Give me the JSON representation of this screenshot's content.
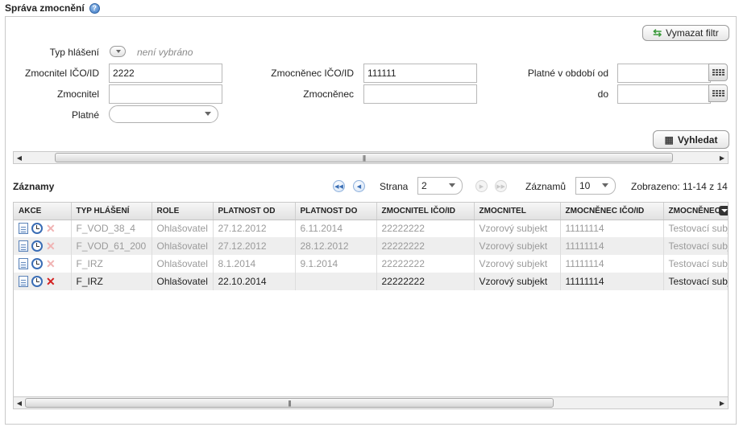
{
  "page": {
    "title": "Správa zmocnění"
  },
  "filter": {
    "clear_button": "Vymazat filtr",
    "typ_label": "Typ hlášení",
    "typ_value": "není vybráno",
    "zmocnitel_ico_label": "Zmocnitel IČO/ID",
    "zmocnitel_ico_value": "2222",
    "zmocnenec_ico_label": "Zmocněnec IČO/ID",
    "zmocnenec_ico_value": "111111",
    "platne_od_label": "Platné v období od",
    "platne_do_label": "do",
    "zmocnitel_label": "Zmocnitel",
    "zmocnenec_label": "Zmocněnec",
    "platne_label": "Platné",
    "search_button": "Vyhledat"
  },
  "records": {
    "title": "Záznamy",
    "page_label": "Strana",
    "page_value": "2",
    "per_page_label": "Záznamů",
    "per_page_value": "10",
    "shown": "Zobrazeno: 11-14 z 14"
  },
  "grid": {
    "columns": [
      "AKCE",
      "TYP HLÁŠENÍ",
      "ROLE",
      "PLATNOST OD",
      "PLATNOST DO",
      "ZMOCNITEL IČO/ID",
      "ZMOCNITEL",
      "ZMOCNĚNEC IČO/ID",
      "ZMOCNĚNEC"
    ],
    "rows": [
      {
        "typ": "F_VOD_38_4",
        "role": "Ohlašovatel",
        "od": "27.12.2012",
        "do": "6.11.2014",
        "zmocnitel_ico": "22222222",
        "zmocnitel": "Vzorový subjekt",
        "zmocnenec_ico": "11111114",
        "zmocnenec": "Testovací subjekt",
        "active": false
      },
      {
        "typ": "F_VOD_61_200",
        "role": "Ohlašovatel",
        "od": "27.12.2012",
        "do": "28.12.2012",
        "zmocnitel_ico": "22222222",
        "zmocnitel": "Vzorový subjekt",
        "zmocnenec_ico": "11111114",
        "zmocnenec": "Testovací subjekt",
        "active": false
      },
      {
        "typ": "F_IRZ",
        "role": "Ohlašovatel",
        "od": "8.1.2014",
        "do": "9.1.2014",
        "zmocnitel_ico": "22222222",
        "zmocnitel": "Vzorový subjekt",
        "zmocnenec_ico": "11111114",
        "zmocnenec": "Testovací subjekt",
        "active": false
      },
      {
        "typ": "F_IRZ",
        "role": "Ohlašovatel",
        "od": "22.10.2014",
        "do": "",
        "zmocnitel_ico": "22222222",
        "zmocnitel": "Vzorový subjekt",
        "zmocnenec_ico": "11111114",
        "zmocnenec": "Testovací subjekt",
        "active": true
      }
    ]
  },
  "icons": {
    "help": "help-icon",
    "refresh": "refresh-icon",
    "search": "binoculars-icon",
    "calendar": "calendar-icon",
    "document": "document-icon",
    "clock": "clock-icon",
    "delete": "delete-icon"
  },
  "colors": {
    "delete_active": "#d31f1f",
    "delete_disabled": "#f0b3b3",
    "inactive_text": "#9a9a9a"
  }
}
